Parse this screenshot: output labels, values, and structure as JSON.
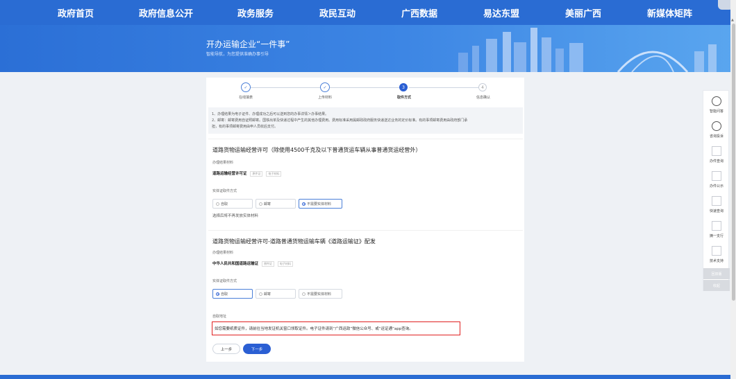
{
  "nav": {
    "items": [
      "政府首页",
      "政府信息公开",
      "政务服务",
      "政民互动",
      "广西数据",
      "易达东盟",
      "美丽广西",
      "新媒体矩阵"
    ]
  },
  "banner": {
    "title": "开办运输企业“一件事”",
    "subtitle": "智能导航，为您提供准确办事引导"
  },
  "steps": [
    {
      "label": "在线填表",
      "state": "done",
      "mark": "✓"
    },
    {
      "label": "上传材料",
      "state": "done",
      "mark": "✓"
    },
    {
      "label": "取件方式",
      "state": "current",
      "mark": "3"
    },
    {
      "label": "信息确认",
      "state": "pending",
      "mark": "4"
    }
  ],
  "notice": {
    "line1": "1、办理结果为电子证件、办理成功之后可以送到您的办事详情＞办事结果。",
    "line2": "2、邮寄：邮寄费用自证照邮寄。国铁出单及快递过程中产生的其他办理费用。费用标准采用属邮政政府服务快递送达业务的定价标准。有的事项邮寄费用由政府部门承",
    "line3": "担，有的事项邮寄费用由申人员收后支付。"
  },
  "section1": {
    "title": "道路货物运输经营许可（除使用4500千克及以下普通货运车辆从事普通货运经营外）",
    "result_label": "办理结果材料",
    "result_item": "道路运输经营许可证",
    "tag1": "原件证",
    "tag2": "电子材料",
    "pickup_label": "实体证取件方式",
    "options": [
      "自取",
      "邮寄",
      "不需要实体材料"
    ],
    "selected_index": 2,
    "hint": "选择后将不再发放实体材料"
  },
  "section2": {
    "title": "道路货物运输经营许可-道路普通货物运输车辆《道路运输证》配发",
    "result_label": "办理结果材料",
    "result_item": "中华人民共和国道路运输证",
    "tag1": "原件证",
    "tag2": "电子材料",
    "pickup_label": "实体证取件方式",
    "options": [
      "自取",
      "邮寄",
      "不需要实体材料"
    ],
    "selected_index": 0,
    "address_label": "自取地址",
    "address_text": "如您需要纸质证件，请前往当地发证机关窗口领取证件。电子证件请到“广西运政”微信公众号、或“运证通”app查询。"
  },
  "buttons": {
    "prev": "上一步",
    "next": "下一步"
  },
  "rail": {
    "items": [
      {
        "label": "智能问答",
        "icon": "robot-icon"
      },
      {
        "label": "咨询投诉",
        "icon": "chat-icon"
      },
      {
        "label": "办件查询",
        "icon": "broken-image-icon"
      },
      {
        "label": "办件公示",
        "icon": "broken-image-icon"
      },
      {
        "label": "快速查询",
        "icon": "broken-image-icon"
      },
      {
        "label": "摘一支行",
        "icon": "broken-image-icon"
      },
      {
        "label": "技术支持",
        "icon": "broken-image-icon"
      }
    ],
    "back": "回旧版",
    "top": "收起"
  },
  "colors": {
    "primary": "#2b5fd3",
    "nav": "#2a6cd3",
    "highlight": "#e02020"
  }
}
